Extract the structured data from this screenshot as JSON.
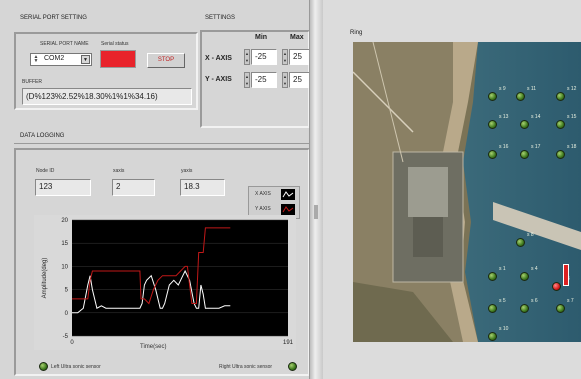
{
  "serial_port": {
    "section_title": "SERIAL PORT SETTING",
    "name_label": "SERIAL PORT NAME",
    "name_value": "COM2",
    "status_label": "Serial status",
    "status_color": "#e8232b",
    "stop_label": "STOP",
    "buffer_label": "BUFFER",
    "buffer_value": "(D%123%2.52%18.30%1%1%34.16)"
  },
  "settings": {
    "section_title": "SETTINGS",
    "min_header": "Min",
    "max_header": "Max",
    "x_label": "X - AXIS",
    "y_label": "Y - AXIS",
    "x_min": "-25",
    "x_max": "25",
    "y_min": "-25",
    "y_max": "25"
  },
  "logging": {
    "section_title": "DATA LOGGING",
    "node_label": "Node ID",
    "node_value": "123",
    "xaxis_label": "xaxis",
    "xaxis_value": "2",
    "yaxis_label": "yaxis",
    "yaxis_value": "18.3",
    "legend": [
      {
        "name": "X AXIS",
        "color": "#ffffff"
      },
      {
        "name": "Y AXIS",
        "color": "#c01818"
      }
    ],
    "left_sensor_label": "Left Ultra sonic sensor",
    "right_sensor_label": "Right Ultra sonic sensor"
  },
  "chart_data": {
    "type": "line",
    "ylabel": "Amplitude(deg)",
    "xlabel": "Time(sec)",
    "xlim": [
      0,
      191
    ],
    "ylim": [
      -5,
      20
    ],
    "yticks": [
      "20",
      "15",
      "10",
      "5",
      "0",
      "-5"
    ],
    "xticks": [
      "0",
      "191"
    ],
    "series": [
      {
        "name": "X AXIS",
        "color": "#ffffff",
        "x": [
          0,
          5,
          10,
          14,
          16,
          18,
          22,
          26,
          30,
          35,
          40,
          45,
          50,
          55,
          60,
          62,
          64,
          66,
          70,
          74,
          78,
          80,
          82,
          86,
          90,
          94,
          98,
          100,
          104,
          108,
          110,
          112,
          114,
          116,
          118,
          120,
          125,
          130,
          135,
          140
        ],
        "y": [
          0,
          0,
          1,
          6,
          8,
          5,
          1,
          1.5,
          1,
          1,
          1,
          1,
          1,
          1,
          1,
          2,
          6,
          7,
          8,
          5,
          1,
          1,
          2,
          6,
          7,
          6,
          8,
          9,
          7,
          2,
          1,
          1,
          6,
          4,
          1,
          1,
          1,
          1,
          1.5,
          1.5
        ]
      },
      {
        "name": "Y AXIS",
        "color": "#c01818",
        "x": [
          0,
          5,
          10,
          14,
          16,
          18,
          20,
          25,
          30,
          35,
          40,
          45,
          50,
          55,
          60,
          61,
          64,
          68,
          72,
          76,
          80,
          84,
          88,
          92,
          96,
          100,
          102,
          104,
          106,
          108,
          110,
          112,
          114,
          116,
          118,
          120,
          122,
          125,
          130,
          135,
          140
        ],
        "y": [
          3,
          3,
          3,
          3,
          7,
          9,
          9,
          9,
          9,
          9,
          9,
          9,
          9,
          9,
          9,
          3,
          3,
          2,
          5,
          7,
          8,
          8,
          8,
          8,
          9,
          10,
          10,
          6,
          2,
          2,
          2,
          13,
          13,
          13,
          18.3,
          18.3,
          18.3,
          18.3,
          18.3,
          18.3,
          18.3
        ]
      }
    ]
  },
  "ring": {
    "title": "Ring",
    "nodes": [
      "s 9",
      "s 11",
      "s 12",
      "s 13",
      "s 14",
      "s 15",
      "s 16",
      "s 17",
      "s 18",
      "s 8",
      "s 1",
      "s 4",
      "s 5",
      "s 6",
      "s 7",
      "s 10",
      "s 3"
    ]
  }
}
